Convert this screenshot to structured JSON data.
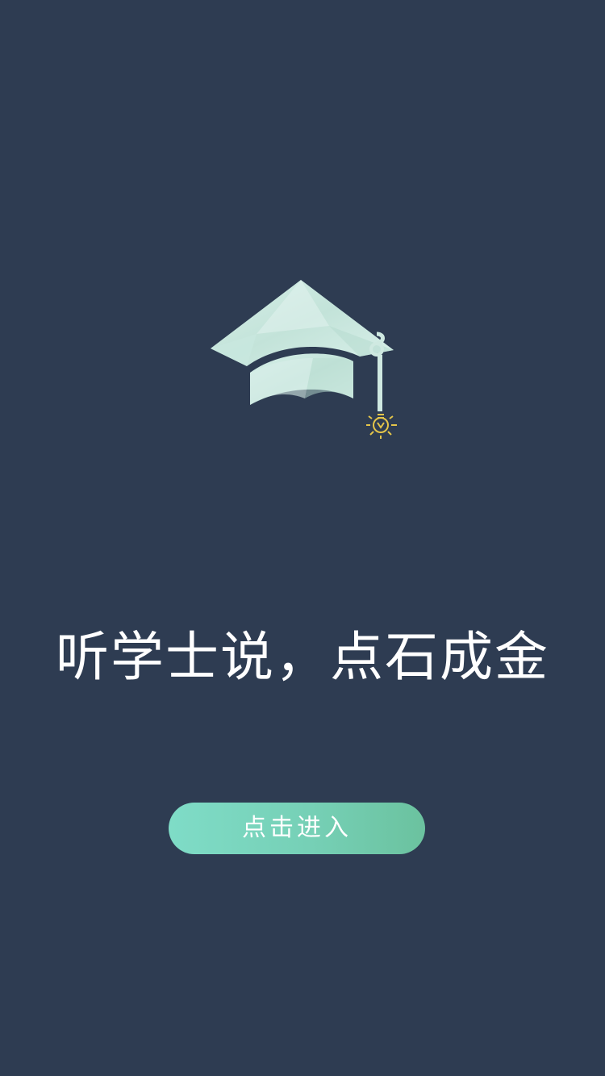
{
  "page": {
    "background_color": "#2e3c52"
  },
  "logo": {
    "icon": "graduation-cap-lightbulb-icon",
    "cap_color": "#cfe9e1",
    "bulb_color": "#e4c54a"
  },
  "slogan": {
    "text": "听学士说，点石成金"
  },
  "enter_button": {
    "label": "点击进入",
    "gradient_start": "#7fdcc7",
    "gradient_end": "#6bc29f"
  }
}
